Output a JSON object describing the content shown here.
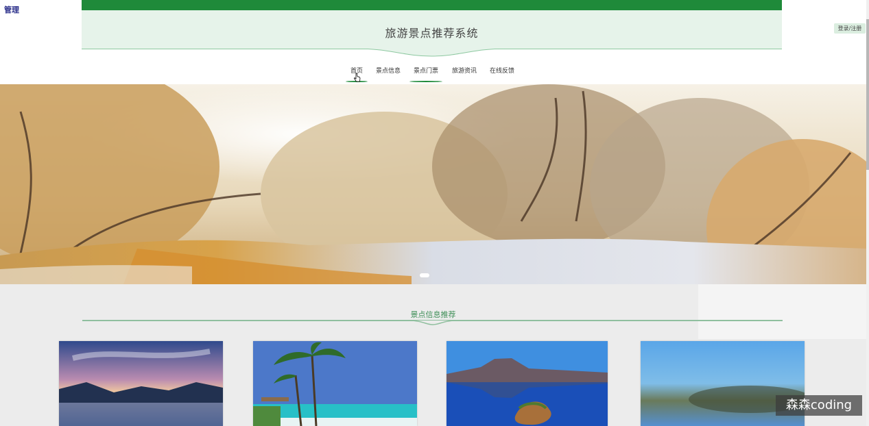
{
  "corner": {
    "text": "管理"
  },
  "header": {
    "title": "旅游景点推荐系统",
    "login_label": "登录/注册"
  },
  "nav": {
    "items": [
      {
        "label": "首页",
        "state": "hover"
      },
      {
        "label": "景点信息"
      },
      {
        "label": "景点门票",
        "state": "active"
      },
      {
        "label": "旅游资讯"
      },
      {
        "label": "在线反馈"
      }
    ]
  },
  "section": {
    "title": "景点信息推荐"
  },
  "watermark": {
    "text": "森森coding"
  },
  "colors": {
    "brand_green": "#1f8a3a",
    "header_bg": "#e6f3ea",
    "section_title": "#3f8f58"
  },
  "carousel": {
    "active_slide": 1,
    "slide_count": 1
  }
}
